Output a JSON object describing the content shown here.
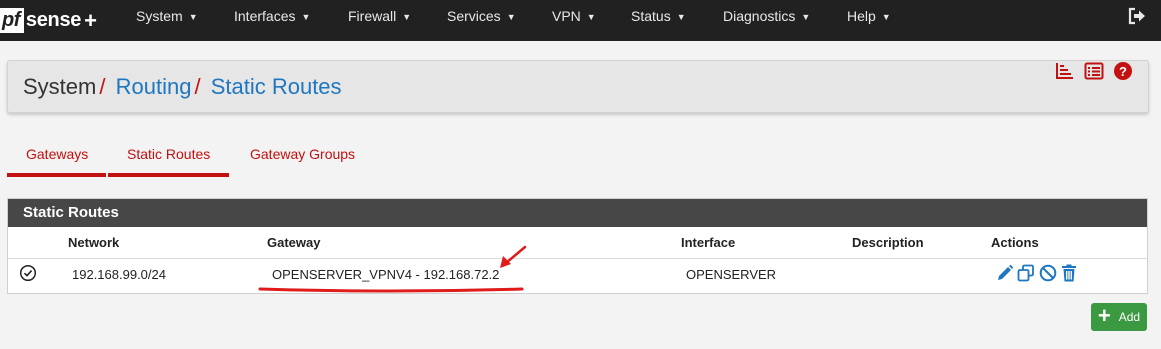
{
  "navbar": {
    "logo": {
      "pf": "pf",
      "rest": "sense",
      "plus": "+"
    },
    "items": [
      {
        "label": "System"
      },
      {
        "label": "Interfaces"
      },
      {
        "label": "Firewall"
      },
      {
        "label": "Services"
      },
      {
        "label": "VPN"
      },
      {
        "label": "Status"
      },
      {
        "label": "Diagnostics"
      },
      {
        "label": "Help"
      }
    ],
    "logout_icon": "logout-icon"
  },
  "breadcrumb": {
    "root": "System",
    "sep": "/",
    "links": [
      "Routing",
      "Static Routes"
    ],
    "icons": [
      "log-icon",
      "list-icon",
      "help-icon"
    ]
  },
  "tabs": [
    "Gateways",
    "Static Routes",
    "Gateway Groups"
  ],
  "panel": {
    "title": "Static Routes",
    "columns": [
      "Network",
      "Gateway",
      "Interface",
      "Description",
      "Actions"
    ],
    "rows": [
      {
        "status_icon": "check-circle-icon",
        "network": "192.168.99.0/24",
        "gateway": "OPENSERVER_VPNV4 - 192.168.72.2",
        "interface": "OPENSERVER",
        "description": "",
        "actions": [
          "edit-icon",
          "copy-icon",
          "disable-icon",
          "delete-icon"
        ]
      }
    ]
  },
  "add_button": {
    "label": "Add"
  },
  "colors": {
    "navbar": "#212121",
    "accent_red": "#c31010",
    "link_blue": "#1e77c0",
    "panel_head": "#474747",
    "add_green": "#3b9a41"
  }
}
